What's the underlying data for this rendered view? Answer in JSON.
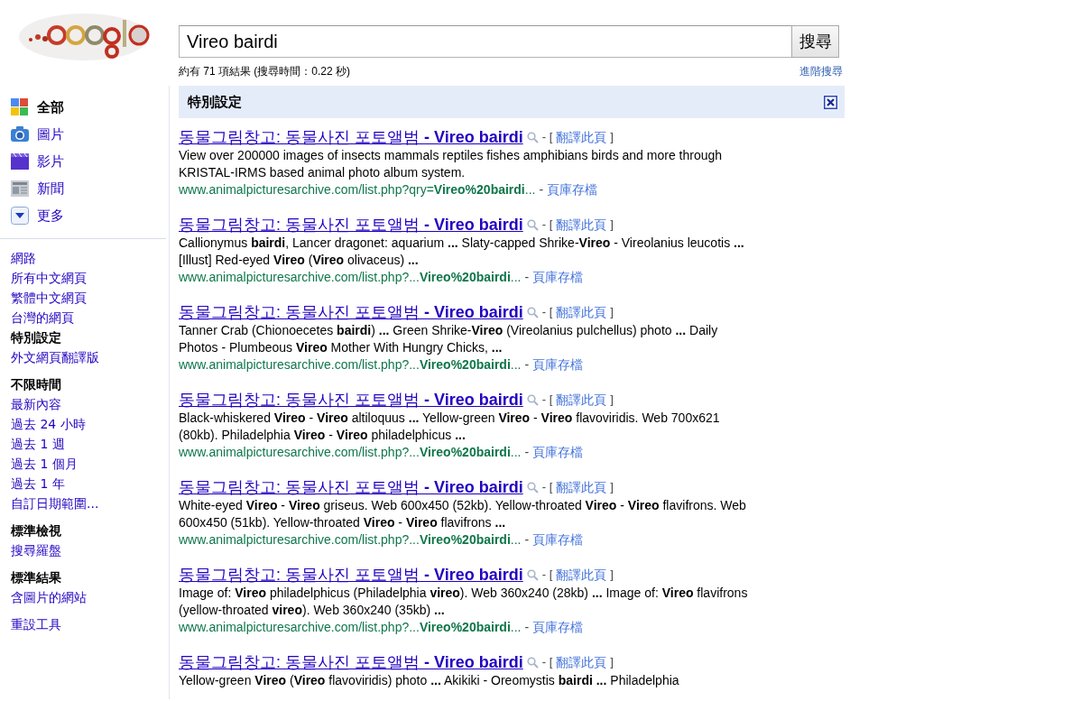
{
  "search": {
    "query": "Vireo bairdi",
    "button": "搜尋",
    "stats": "約有 71 項結果 (搜尋時間：0.22 秒)",
    "advanced": "進階搜尋"
  },
  "sidebar": {
    "nav": [
      {
        "label": "全部",
        "selected": true
      },
      {
        "label": "圖片",
        "selected": false
      },
      {
        "label": "影片",
        "selected": false
      },
      {
        "label": "新聞",
        "selected": false
      },
      {
        "label": "更多",
        "selected": false
      }
    ],
    "sections": [
      {
        "items": [
          {
            "label": "網路",
            "selected": false
          },
          {
            "label": "所有中文網頁",
            "selected": false
          },
          {
            "label": "繁體中文網頁",
            "selected": false
          },
          {
            "label": "台灣的網頁",
            "selected": false
          },
          {
            "label": "特別設定",
            "selected": true
          },
          {
            "label": "外文網頁翻譯版",
            "selected": false
          }
        ]
      },
      {
        "items": [
          {
            "label": "不限時間",
            "selected": true
          },
          {
            "label": "最新內容",
            "selected": false
          },
          {
            "label": "過去 24 小時",
            "selected": false
          },
          {
            "label": "過去 1 週",
            "selected": false
          },
          {
            "label": "過去 1 個月",
            "selected": false
          },
          {
            "label": "過去 1 年",
            "selected": false
          },
          {
            "label": "自訂日期範圍...",
            "selected": false
          }
        ]
      },
      {
        "items": [
          {
            "label": "標準檢視",
            "selected": true
          },
          {
            "label": "搜尋羅盤",
            "selected": false
          }
        ]
      },
      {
        "items": [
          {
            "label": "標準結果",
            "selected": true
          },
          {
            "label": "含圖片的網站",
            "selected": false
          }
        ]
      },
      {
        "items": [
          {
            "label": "重設工具",
            "selected": false
          }
        ]
      }
    ]
  },
  "results_header": {
    "title": "特別設定"
  },
  "results": [
    {
      "title": "동물그림창고: 동물사진 포토앨범 **- Vireo bairdi**",
      "translate_open": "- [",
      "translate": "翻譯此頁",
      "translate_close": "]",
      "snippet": "View over 200000 images of insects mammals reptiles fishes amphibians birds and more through KRISTAL-IRMS based animal photo album system.",
      "url": "www.animalpicturesarchive.com/list.php?qry=**Vireo%20bairdi**...",
      "cache_sep": "-",
      "cache": "頁庫存檔"
    },
    {
      "title": "동물그림창고: 동물사진 포토앨범 **- Vireo bairdi**",
      "translate_open": "- [",
      "translate": "翻譯此頁",
      "translate_close": "]",
      "snippet": "Callionymus **bairdi**, Lancer dragonet: aquarium **...** Slaty-capped Shrike-**Vireo** - Vireolanius leucotis **...** [Illust] Red-eyed **Vireo** (**Vireo** olivaceus) **...**",
      "url": "www.animalpicturesarchive.com/list.php?...**Vireo%20bairdi**...",
      "cache_sep": "-",
      "cache": "頁庫存檔"
    },
    {
      "title": "동물그림창고: 동물사진 포토앨범 **- Vireo bairdi**",
      "translate_open": "- [",
      "translate": "翻譯此頁",
      "translate_close": "]",
      "snippet": "Tanner Crab (Chionoecetes **bairdi**) **...** Green Shrike-**Vireo** (Vireolanius pulchellus) photo **...** Daily Photos - Plumbeous **Vireo** Mother With Hungry Chicks, **...**",
      "url": "www.animalpicturesarchive.com/list.php?...**Vireo%20bairdi**...",
      "cache_sep": "-",
      "cache": "頁庫存檔"
    },
    {
      "title": "동물그림창고: 동물사진 포토앨범 **- Vireo bairdi**",
      "translate_open": "- [",
      "translate": "翻譯此頁",
      "translate_close": "]",
      "snippet": "Black-whiskered **Vireo** - **Vireo** altiloquus **...** Yellow-green **Vireo** - **Vireo** flavoviridis. Web 700x621 (80kb). Philadelphia **Vireo** - **Vireo** philadelphicus **...**",
      "url": "www.animalpicturesarchive.com/list.php?...**Vireo%20bairdi**...",
      "cache_sep": "-",
      "cache": "頁庫存檔"
    },
    {
      "title": "동물그림창고: 동물사진 포토앨범 **- Vireo bairdi**",
      "translate_open": "- [",
      "translate": "翻譯此頁",
      "translate_close": "]",
      "snippet": "White-eyed **Vireo** - **Vireo** griseus. Web 600x450 (52kb). Yellow-throated **Vireo** - **Vireo** flavifrons. Web 600x450 (51kb). Yellow-throated **Vireo** - **Vireo** flavifrons **...**",
      "url": "www.animalpicturesarchive.com/list.php?...**Vireo%20bairdi**...",
      "cache_sep": "-",
      "cache": "頁庫存檔"
    },
    {
      "title": "동물그림창고: 동물사진 포토앨범 **- Vireo bairdi**",
      "translate_open": "- [",
      "translate": "翻譯此頁",
      "translate_close": "]",
      "snippet": "Image of: **Vireo** philadelphicus (Philadelphia **vireo**). Web 360x240 (28kb) **...** Image of: **Vireo** flavifrons (yellow-throated **vireo**). Web 360x240 (35kb) **...**",
      "url": "www.animalpicturesarchive.com/list.php?...**Vireo%20bairdi**...",
      "cache_sep": "-",
      "cache": "頁庫存檔"
    },
    {
      "title": "동물그림창고: 동물사진 포토앨범 **- Vireo bairdi**",
      "translate_open": "- [",
      "translate": "翻譯此頁",
      "translate_close": "]",
      "snippet": "Yellow-green **Vireo** (**Vireo** flavoviridis) photo **...** Akikiki - Oreomystis **bairdi** **...** Philadelphia"
    }
  ]
}
